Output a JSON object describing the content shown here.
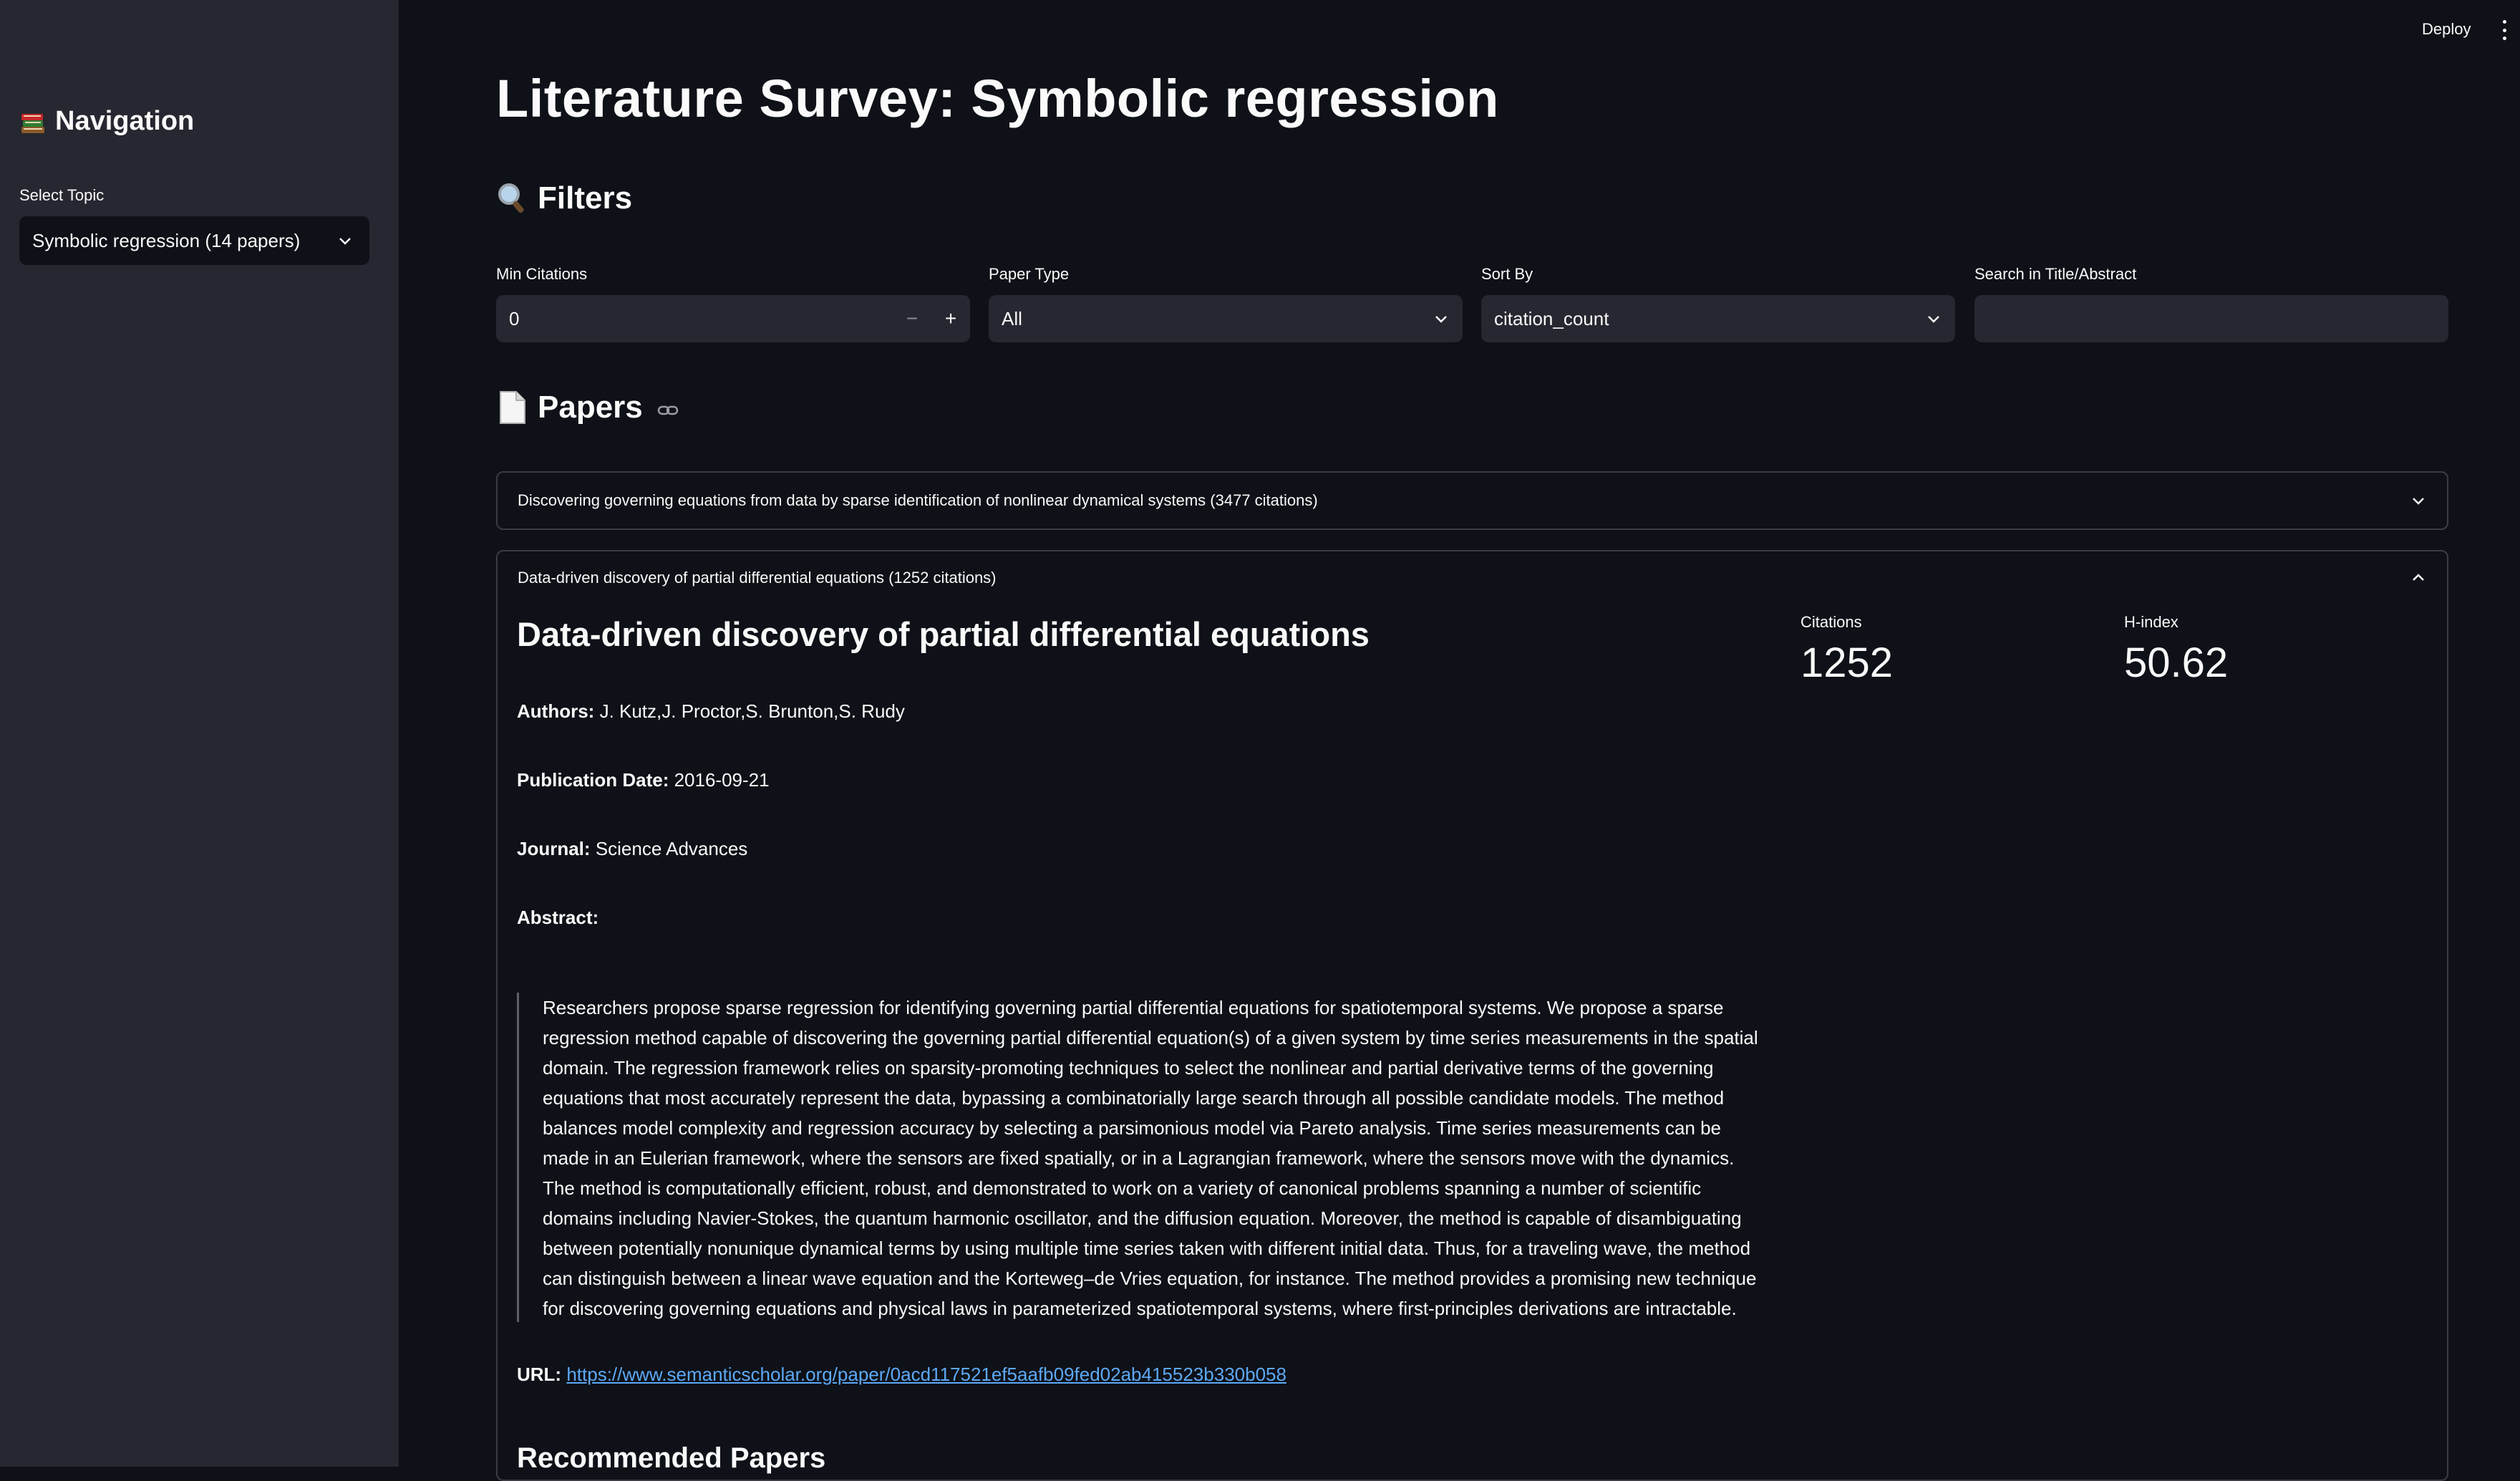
{
  "header": {
    "deploy_label": "Deploy",
    "menu_icon": "kebab-menu-icon"
  },
  "sidebar": {
    "nav_icon": "books-icon",
    "nav_title": "Navigation",
    "select_label": "Select Topic",
    "select_value": "Symbolic regression (14 papers)"
  },
  "main": {
    "title": "Literature Survey: Symbolic regression",
    "filters": {
      "heading": "Filters",
      "icon": "magnifier-icon",
      "min_citations": {
        "label": "Min Citations",
        "value": "0",
        "minus": "−",
        "plus": "+"
      },
      "paper_type": {
        "label": "Paper Type",
        "value": "All"
      },
      "sort_by": {
        "label": "Sort By",
        "value": "citation_count"
      },
      "search": {
        "label": "Search in Title/Abstract",
        "value": ""
      }
    },
    "papers": {
      "heading": "Papers",
      "icon": "document-icon",
      "items": [
        {
          "header": "Discovering governing equations from data by sparse identification of nonlinear dynamical systems (3477 citations)",
          "expanded": false
        },
        {
          "header": "Data-driven discovery of partial differential equations (1252 citations)",
          "expanded": true,
          "title": "Data-driven discovery of partial differential equations",
          "authors_label": "Authors:",
          "authors": "J. Kutz,J. Proctor,S. Brunton,S. Rudy",
          "date_label": "Publication Date:",
          "date": "2016-09-21",
          "journal_label": "Journal:",
          "journal": "Science Advances",
          "abstract_label": "Abstract:",
          "abstract": "Researchers propose sparse regression for identifying governing partial differential equations for spatiotemporal systems. We propose a sparse regression method capable of discovering the governing partial differential equation(s) of a given system by time series measurements in the spatial domain. The regression framework relies on sparsity-promoting techniques to select the nonlinear and partial derivative terms of the governing equations that most accurately represent the data, bypassing a combinatorially large search through all possible candidate models. The method balances model complexity and regression accuracy by selecting a parsimonious model via Pareto analysis. Time series measurements can be made in an Eulerian framework, where the sensors are fixed spatially, or in a Lagrangian framework, where the sensors move with the dynamics. The method is computationally efficient, robust, and demonstrated to work on a variety of canonical problems spanning a number of scientific domains including Navier-Stokes, the quantum harmonic oscillator, and the diffusion equation. Moreover, the method is capable of disambiguating between potentially nonunique dynamical terms by using multiple time series taken with different initial data. Thus, for a traveling wave, the method can distinguish between a linear wave equation and the Korteweg–de Vries equation, for instance. The method provides a promising new technique for discovering governing equations and physical laws in parameterized spatiotemporal systems, where first-principles derivations are intractable.",
          "url_label": "URL:",
          "url": "https://www.semanticscholar.org/paper/0acd117521ef5aafb09fed02ab415523b330b058",
          "citations_label": "Citations",
          "citations": "1252",
          "hindex_label": "H-index",
          "hindex": "50.62",
          "recommended_heading": "Recommended Papers"
        }
      ]
    }
  }
}
